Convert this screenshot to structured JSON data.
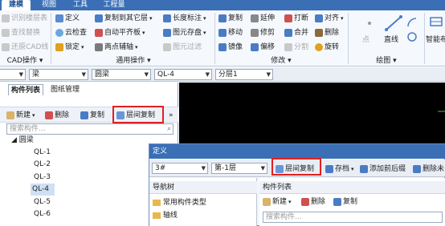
{
  "menubar": {
    "tabs": [
      "建模",
      "视图",
      "工具",
      "工程量"
    ],
    "active": "建模"
  },
  "ribbon": {
    "cad": {
      "items": [
        "识别楼层表",
        "查找替换",
        "还原CAD线"
      ],
      "label": "CAD操作"
    },
    "general": {
      "items": [
        "定义",
        "云检查",
        "锁定",
        "复制到其它层",
        "自动平齐板",
        "两点辅轴",
        "长度标注",
        "图元存盘",
        "图元过滤"
      ],
      "label": "通用操作"
    },
    "modify": {
      "items": [
        "复制",
        "延伸",
        "打断",
        "对齐",
        "移动",
        "修剪",
        "合并",
        "删除",
        "镜像",
        "偏移",
        "分割",
        "旋转"
      ],
      "label": "修改"
    },
    "draw": {
      "items": [
        "点",
        "直线"
      ],
      "label": "绘图"
    },
    "smart": {
      "label": "智能布"
    }
  },
  "selectors": {
    "beam": "梁",
    "circ_beam": "圆梁",
    "component": "QL-4",
    "layer": "分层1"
  },
  "left_panel": {
    "tabs": [
      "构件列表",
      "图纸管理"
    ],
    "toolbar": {
      "new": "新建",
      "delete": "删除",
      "copy": "复制",
      "floor_copy": "层间复制",
      "more": "»"
    },
    "search_placeholder": "搜索构件...",
    "tree": {
      "root": "圆梁",
      "items": [
        "QL-1",
        "QL-2",
        "QL-3",
        "QL-4",
        "QL-5",
        "QL-6"
      ],
      "selected_index": 3
    }
  },
  "dialog": {
    "title": "定义",
    "floor_num": "3#",
    "floor_layer": "第-1层",
    "toolbar": {
      "floor_copy": "层间复制",
      "save": "存档",
      "add_prefix_suffix": "添加前后缀",
      "delete_unused": "删除未"
    },
    "nav_tree": {
      "header": "导航树",
      "items": [
        "常用构件类型",
        "轴线"
      ]
    },
    "component_list": {
      "header": "构件列表",
      "new": "新建",
      "delete": "删除",
      "copy": "复制",
      "search_placeholder": "搜索构件..."
    }
  },
  "colors": {
    "menubar": "#3a6fb6",
    "highlight_box": "#e02020",
    "selection": "#cfe0f5",
    "canvas": "#000000"
  }
}
